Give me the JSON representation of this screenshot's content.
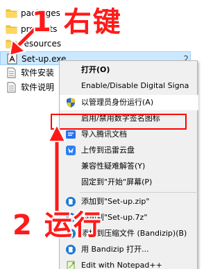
{
  "files": [
    {
      "name": "packages",
      "type": "folder",
      "trailing": ""
    },
    {
      "name": "products",
      "type": "folder",
      "trailing": ""
    },
    {
      "name": "resources",
      "type": "folder",
      "trailing": ""
    },
    {
      "name": "Set-up.exe",
      "type": "exe",
      "trailing": "2"
    },
    {
      "name": "软件安装",
      "type": "doc",
      "trailing": ""
    },
    {
      "name": "软件说明",
      "type": "doc",
      "trailing": "2"
    }
  ],
  "context_menu": {
    "items": [
      {
        "label": "打开(O)",
        "icon": "none",
        "bold": true
      },
      {
        "label": "Enable/Disable Digital Signa",
        "icon": "none"
      },
      {
        "label": "以管理员身份运行(A)",
        "icon": "uac-shield-icon",
        "highlighted": true
      },
      {
        "label": "启用/禁用数字签名图标",
        "icon": "none"
      },
      {
        "label": "导入腾讯文档",
        "icon": "tencent-docs-icon"
      },
      {
        "label": "上传到迅雷云盘",
        "icon": "thunder-icon"
      },
      {
        "label": "兼容性疑难解答(Y)",
        "icon": "none"
      },
      {
        "label": "固定到\"开始\"屏幕(P)",
        "icon": "none"
      },
      {
        "label": "添加到\"Set-up.zip\"",
        "icon": "bandizip-icon"
      },
      {
        "label": "添加到\"Set-up.7z\"",
        "icon": "bandizip-icon"
      },
      {
        "label": "添加到压缩文件 (Bandizip)(B)",
        "icon": "bandizip-icon"
      },
      {
        "label": "用 Bandizip 打开...",
        "icon": "bandizip-icon"
      },
      {
        "label": "Edit with Notepad++",
        "icon": "notepad-plus-plus-icon"
      }
    ]
  },
  "annotations": {
    "step1": "1 右键",
    "step2": "2 运行",
    "color": "#ff1a1a"
  }
}
